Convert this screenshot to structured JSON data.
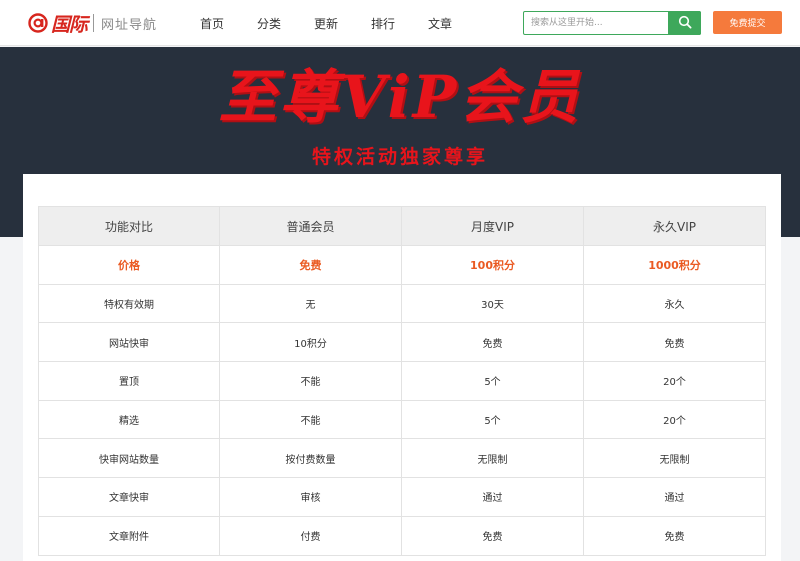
{
  "header": {
    "logo_main": "国际",
    "logo_sub": "网址导航",
    "nav": [
      "首页",
      "分类",
      "更新",
      "排行",
      "文章"
    ],
    "search_placeholder": "搜索从这里开始...",
    "submit_label": "免费提交"
  },
  "banner": {
    "title": "至尊ViP会员",
    "subtitle": "特权活动独家尊享"
  },
  "table": {
    "headers": [
      "功能对比",
      "普通会员",
      "月度VIP",
      "永久VIP"
    ],
    "rows": [
      [
        "价格",
        "免费",
        "100积分",
        "1000积分"
      ],
      [
        "特权有效期",
        "无",
        "30天",
        "永久"
      ],
      [
        "网站快审",
        "10积分",
        "免费",
        "免费"
      ],
      [
        "置顶",
        "不能",
        "5个",
        "20个"
      ],
      [
        "精选",
        "不能",
        "5个",
        "20个"
      ],
      [
        "快审网站数量",
        "按付费数量",
        "无限制",
        "无限制"
      ],
      [
        "文章快审",
        "审核",
        "通过",
        "通过"
      ],
      [
        "文章附件",
        "付费",
        "免费",
        "免费"
      ]
    ]
  },
  "colors": {
    "brand_red": "#d7261e",
    "search_green": "#3ea85b",
    "submit_orange": "#f57a3c",
    "price_orange": "#ea5a22",
    "banner_bg": "#27303d"
  },
  "icons": {
    "logo": "logo-at-icon",
    "search": "search-icon"
  }
}
